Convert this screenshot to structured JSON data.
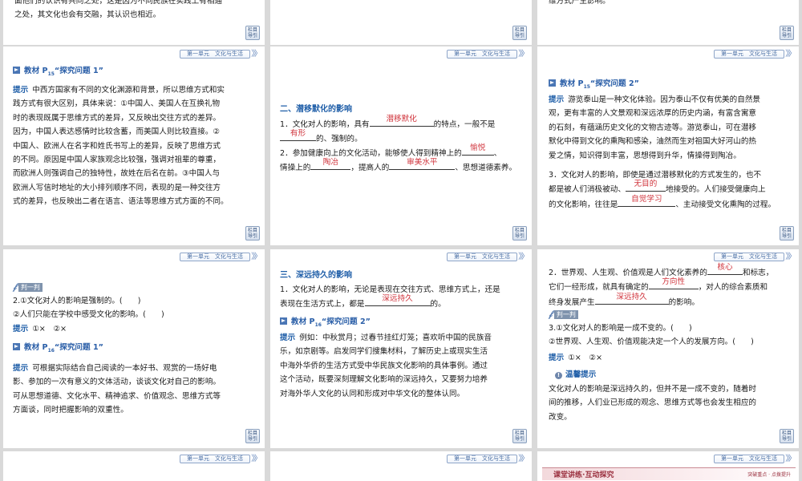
{
  "header": "第一单元　文化与生活",
  "nav_button": [
    "栏目",
    "导引"
  ],
  "s1": {
    "line1": "面他们的认识有共同之处，这是因为不同民族在实践上有相通",
    "line2": "之处，其文化也会有交融，其认识也相近。"
  },
  "s3": {
    "line1": "维方式产生影响。"
  },
  "s4": {
    "title_pre": "教材 P",
    "title_sub": "15",
    "title_post": "“探究问题 1”",
    "tip": "提示",
    "lines": [
      "中西方国家有不同的文化渊源和背景，所以思维方式和实",
      "践方式有很大区别，具体来说：①中国人、美国人在互换礼物",
      "时的表现既属于思维方式的差异，又反映出交往方式的差异。",
      "因为，中国人表达感情时比较含蓄，而美国人则比较直接。②",
      "中国人、欧洲人在名字和姓氏书写上的差异，反映了思维方式",
      "的不同。原因是中国人家族观念比较强，强调对祖辈的尊重，",
      "而欧洲人则强调自己的独特性，故姓在后名在前。③中国人与",
      "欧洲人写信时地址的大小排列顺序不同，表现的是一种交往方",
      "式的差异，也反映出二者在语言、语法等思维方式方面的不同。"
    ]
  },
  "s5": {
    "heading": "二、潜移默化的影响",
    "q1_a": "1．文化对人的影响，具有",
    "q1_b1": "潜移默化",
    "q1_c": "的特点，一般不是",
    "q1_b2": "有形",
    "q1_d": "的、强制的。",
    "q2_a": "2．参加健康向上的文化活动，能够使人得到精神上的",
    "q2_b1": "愉悦",
    "q2_c": "、",
    "q2_d": "情操上的",
    "q2_b2": "陶冶",
    "q2_e": "，提高人的",
    "q2_b3": "审美水平",
    "q2_f": "、思想道德素养。"
  },
  "s6": {
    "title_pre": "教材 P",
    "title_sub": "15",
    "title_post": "“探究问题 2”",
    "tip": "提示",
    "lines": [
      "游览泰山是一种文化体验。因为泰山不仅有优美的自然景",
      "观，更有丰富的人文景观和深远浓厚的历史内涵，有富含寓意",
      "的石刻，有蕴涵历史文化的文物古迹等。游览泰山，可在潜移",
      "默化中得到文化的熏陶和感染，油然而生对祖国大好河山的热",
      "爱之情，知识得到丰富，思想得到升华，情操得到陶冶。"
    ],
    "q3_a": "3．文化对人的影响，即使是通过潜移默化的方式发生的，也不",
    "q3_b": "都是被人们消极被动、",
    "q3_b1": "无目的",
    "q3_c": "地接受的。人们接受健康向上",
    "q3_d": "的文化影响，往往是",
    "q3_b2": "自觉学习",
    "q3_e": "、主动接受文化熏陶的过程。"
  },
  "s7": {
    "judge": "判一判",
    "q1": "2.①文化对人的影响是强制的。(　　)",
    "q2": "②人们只能在学校中感受文化的影响。(　　)",
    "tip": "提示",
    "ans": "①×　②×",
    "title_pre": "教材 P",
    "title_sub": "16",
    "title_post": "“探究问题 1”",
    "tip2": "提示",
    "lines": [
      "可根据实际结合自己阅读的一本好书、观赏的一场好电",
      "影、参加的一次有意义的文体活动，谈谈文化对自己的影响。",
      "可从思想道德、文化水平、精神追求、价值观念、思维方式等",
      "方面谈，同时把握影响的双重性。"
    ]
  },
  "s8": {
    "heading": "三、深远持久的影响",
    "q1_a": "1．文化对人的影响，无论是表现在交往方式、思维方式上，还是",
    "q1_b": "表现在生活方式上，都是",
    "q1_b1": "深远持久",
    "q1_c": "的。",
    "title_pre": "教材 P",
    "title_sub": "16",
    "title_post": "“探究问题 2”",
    "tip": "提示",
    "lines": [
      "例如：中秋赏月；过春节挂红灯笼；喜欢听中国的民族音",
      "乐，如京剧等。启发同学们搜集材料，了解历史上或现实生活",
      "中海外华侨的生活方式受中华民族文化影响的具体事例。通过",
      "这个活动，既要深刻理解文化影响的深远持久，又要努力培养",
      "对海外华人文化的认同和形成对中华文化的整体认同。"
    ]
  },
  "s9": {
    "q2_a": "2．世界观、人生观、价值观是人们文化素养的",
    "q2_b1": "核心",
    "q2_c": "和标志，",
    "q2_d": "它们一经形成，就具有确定的",
    "q2_b2": "方向性",
    "q2_e": "，对人的综合素质和",
    "q2_f": "终身发展产生",
    "q2_b3": "深远持久",
    "q2_g": "的影响。",
    "judge": "判一判",
    "q3": "3.①文化对人的影响是一成不变的。(　　)",
    "q4": "②世界观、人生观、价值观能决定一个人的发展方向。(　　)",
    "tip": "提示",
    "ans": "①×　②×",
    "warm": "温馨提示",
    "lines": [
      "文化对人的影响是深远持久的，但并不是一成不变的，随着时",
      "间的推移，人们业已形成的观念、思维方式等也会发生相应的",
      "改变。"
    ]
  },
  "band": {
    "label1": "课堂讲练",
    "label2": "互动探究",
    "right": "突破重点 · 点拨提升"
  }
}
